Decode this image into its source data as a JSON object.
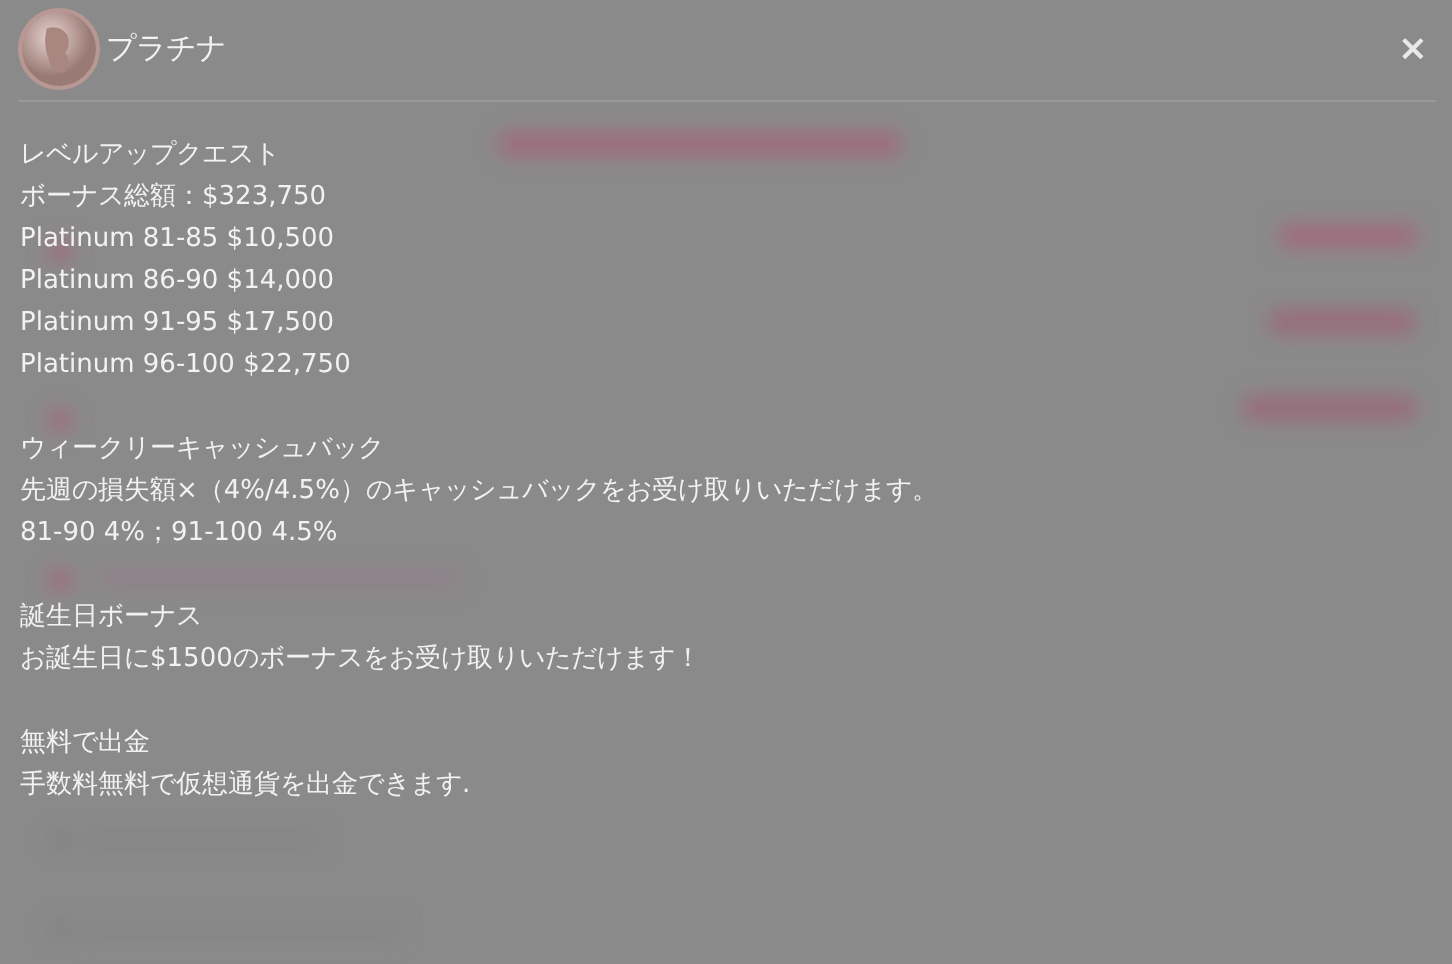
{
  "dialog": {
    "title": "プラチナ",
    "close": "×"
  },
  "sections": [
    {
      "title": "レベルアップクエスト",
      "lines": [
        "ボーナス総額：$323,750",
        "Platinum 81-85 $10,500",
        "Platinum 86-90 $14,000",
        "Platinum 91-95 $17,500",
        "Platinum 96-100 $22,750"
      ]
    },
    {
      "title": "ウィークリーキャッシュバック",
      "lines": [
        "先週の損失額×（4%/4.5%）のキャッシュバックをお受け取りいただけます。",
        "81-90 4%；91-100 4.5%"
      ]
    },
    {
      "title": "誕生日ボーナス",
      "lines": [
        "お誕生日に$1500のボーナスをお受け取りいただけます！"
      ]
    },
    {
      "title": "無料で出金",
      "lines": [
        "手数料無料で仮想通貨を出金できます."
      ]
    }
  ]
}
